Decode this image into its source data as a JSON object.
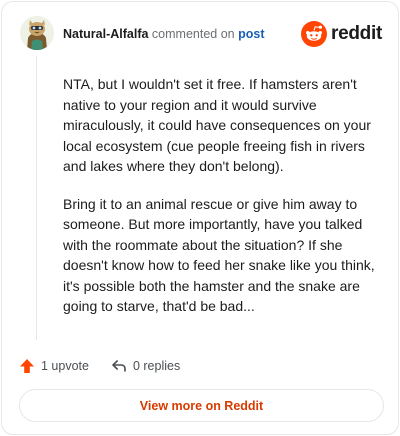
{
  "comment": {
    "username": "Natural-Alfalfa",
    "action_text": "commented on",
    "post_link": "post",
    "paragraphs": [
      "NTA, but I wouldn't set it free. If hamsters aren't native to your region and it would survive miraculously, it could have consequences on your local ecosystem (cue people freeing fish in rivers and lakes where they don't belong).",
      "Bring it to an animal rescue or give him away to someone. But more importantly, have you talked with the roommate about the situation? If she doesn't know how to feed her snake like you think, it's possible both the hamster and the snake are going to starve, that'd be bad..."
    ]
  },
  "brand": {
    "wordmark": "reddit",
    "color": "#ff4500"
  },
  "actions": {
    "upvote_label": "1 upvote",
    "reply_label": "0 replies",
    "upvote_color": "#ff4500"
  },
  "footer": {
    "view_more_label": "View more on Reddit",
    "accent": "#d93a00"
  }
}
